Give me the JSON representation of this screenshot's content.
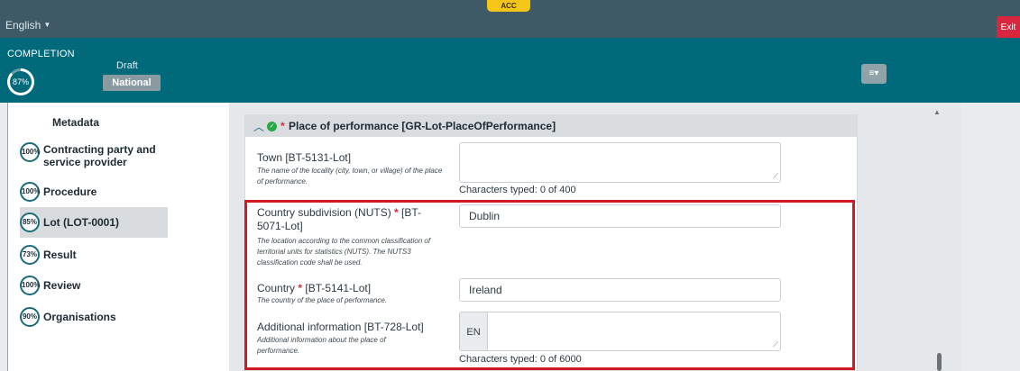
{
  "top": {
    "language": "English",
    "environment_badge": "ACC",
    "exit_label": "Exit"
  },
  "status": {
    "completion_title": "COMPLETION",
    "completion_percent": "87%",
    "completion_fraction": 0.87,
    "draft_label": "Draft",
    "national_label": "National"
  },
  "sidebar": {
    "metadata_label": "Metadata",
    "items": [
      {
        "percent": "100%",
        "label_line1": "Contracting party and",
        "label_line2": "service provider"
      },
      {
        "percent": "100%",
        "label_line1": "Procedure",
        "label_line2": ""
      },
      {
        "percent": "85%",
        "label_line1": "Lot (LOT-0001)",
        "label_line2": ""
      },
      {
        "percent": "73%",
        "label_line1": "Result",
        "label_line2": ""
      },
      {
        "percent": "100%",
        "label_line1": "Review",
        "label_line2": ""
      },
      {
        "percent": "90%",
        "label_line1": "Organisations",
        "label_line2": ""
      }
    ]
  },
  "section": {
    "chevron": "^",
    "required_mark": "*",
    "title": "Place of performance  [GR-Lot-PlaceOfPerformance]"
  },
  "fields": {
    "town": {
      "label": "Town [BT-5131-Lot]",
      "description": "The name of the locality (city, town, or village) of the place of performance.",
      "value": "",
      "counter": "Characters typed: 0 of 400"
    },
    "nuts": {
      "label_before": "Country subdivision (NUTS) ",
      "required": "*",
      "label_after": " [BT-5071-Lot]",
      "description": "The location according to the common classification of territorial units for statistics (NUTS). The NUTS3 classification code shall be used.",
      "value": "Dublin"
    },
    "country": {
      "label_before": "Country ",
      "required": "*",
      "label_after": " [BT-5141-Lot]",
      "description": "The country of the place of performance.",
      "value": "Ireland"
    },
    "additional": {
      "label": "Additional information [BT-728-Lot]",
      "description": "Additional information about the place of performance.",
      "language": "EN",
      "value": "",
      "counter": "Characters typed: 0 of 6000"
    }
  },
  "colors": {
    "header_dark": "#3d5a66",
    "header_teal": "#006a7a",
    "exit_red": "#d9263f",
    "highlight_red": "#d41922",
    "required_red": "#d62b3a",
    "success_green": "#27a844"
  }
}
